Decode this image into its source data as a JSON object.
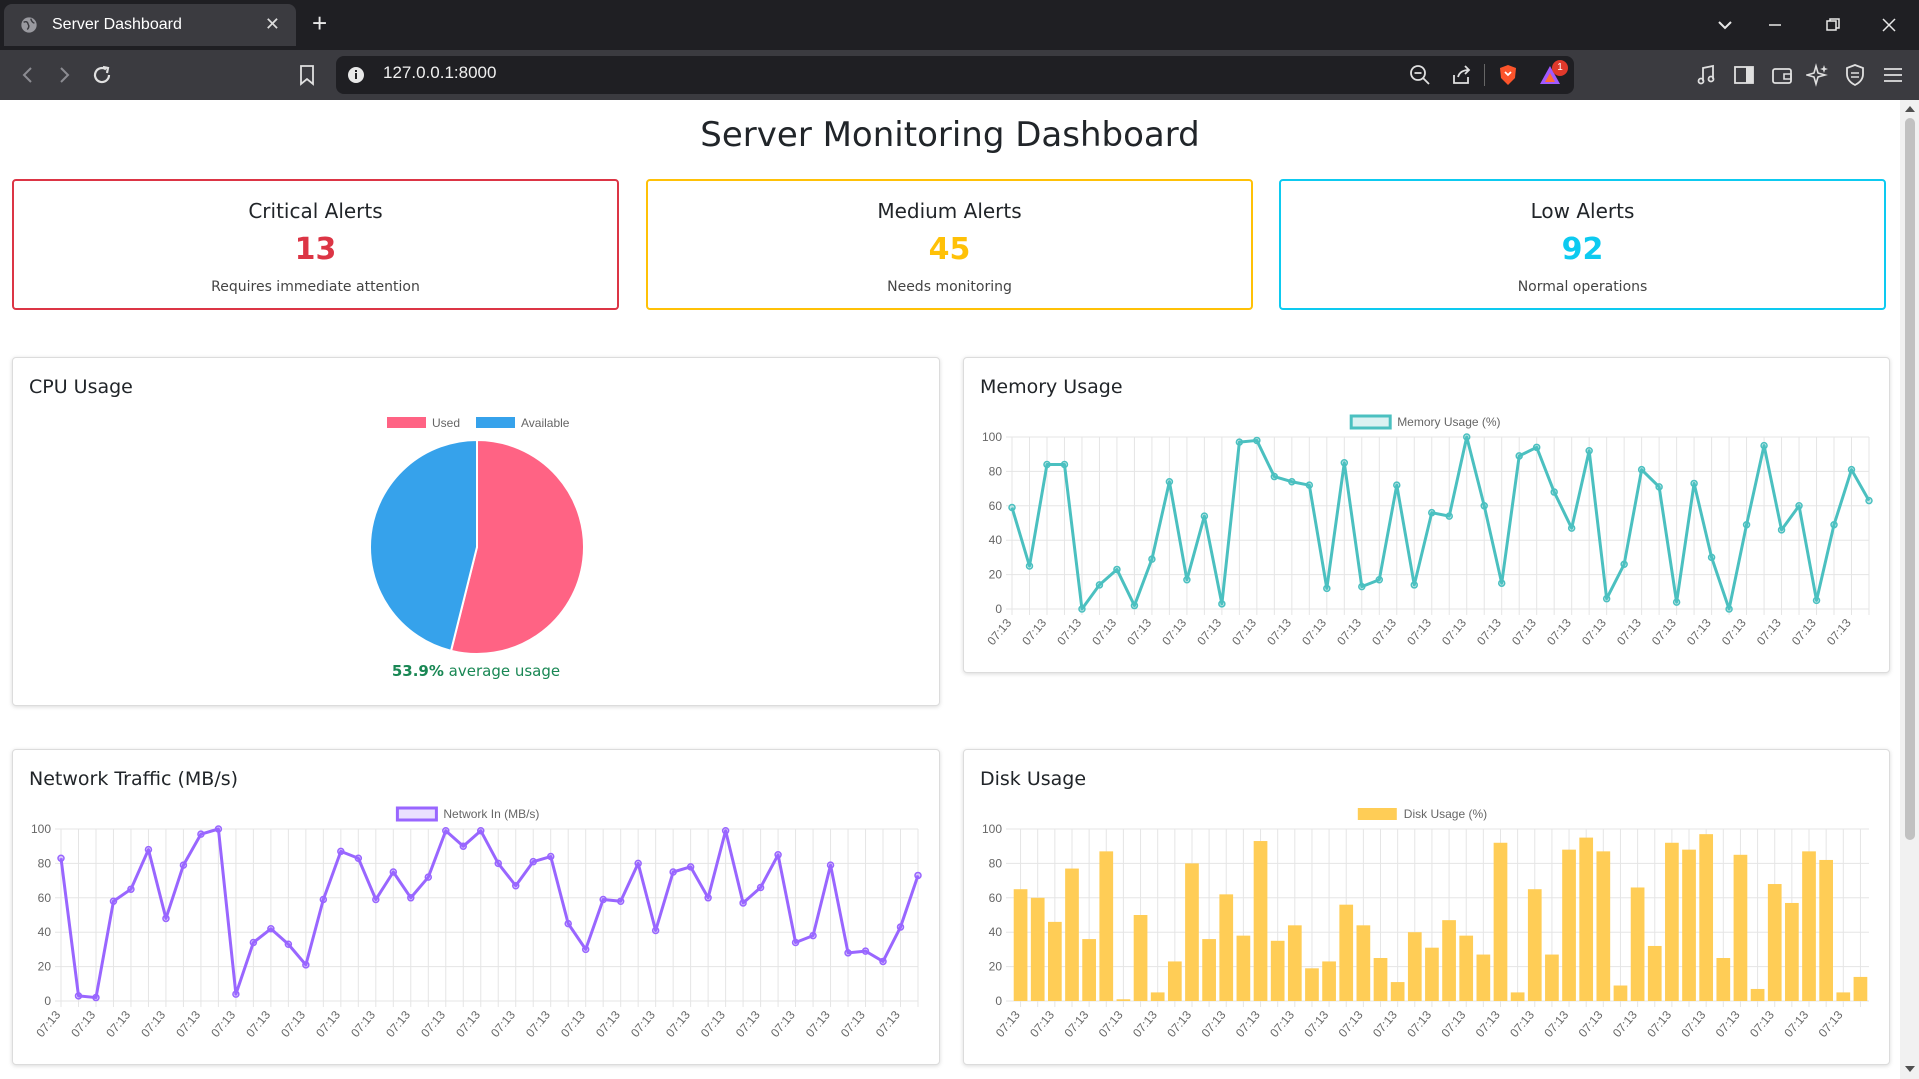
{
  "browser": {
    "tab_title": "Server Dashboard",
    "url": "127.0.0.1:8000",
    "shield_badge": "1"
  },
  "page": {
    "title": "Server Monitoring Dashboard"
  },
  "alerts": [
    {
      "title": "Critical Alerts",
      "count": "13",
      "subtitle": "Requires immediate attention",
      "color": "#dc3545"
    },
    {
      "title": "Medium Alerts",
      "count": "45",
      "subtitle": "Needs monitoring",
      "color": "#ffc107"
    },
    {
      "title": "Low Alerts",
      "count": "92",
      "subtitle": "Normal operations",
      "color": "#0dcaf0"
    }
  ],
  "panels": {
    "cpu": {
      "title": "CPU Usage",
      "avg_value": "53.9%",
      "avg_label": " average usage"
    },
    "memory": {
      "title": "Memory Usage"
    },
    "network": {
      "title": "Network Traffic (MB/s)"
    },
    "disk": {
      "title": "Disk Usage"
    }
  },
  "chart_data": [
    {
      "id": "cpu",
      "type": "pie",
      "title": "CPU Usage",
      "categories": [
        "Used",
        "Available"
      ],
      "values": [
        53.9,
        46.1
      ],
      "colors": [
        "#ff6384",
        "#36a2eb"
      ],
      "legend": "top"
    },
    {
      "id": "memory",
      "type": "line",
      "title": "Memory Usage",
      "series": [
        {
          "name": "Memory Usage (%)",
          "color": "#4bc0c0",
          "values": [
            59,
            25,
            84,
            84,
            0,
            14,
            23,
            2,
            29,
            74,
            17,
            54,
            3,
            97,
            98,
            77,
            74,
            72,
            12,
            85,
            13,
            17,
            72,
            14,
            56,
            54,
            100,
            60,
            15,
            89,
            94,
            68,
            47,
            92,
            6,
            26,
            81,
            71,
            4,
            73,
            30,
            0,
            49,
            95,
            46,
            60,
            5,
            49,
            81,
            63
          ]
        }
      ],
      "x_tick_label": "07:13",
      "x_tick_count": 25,
      "ylim": [
        0,
        100
      ],
      "y_ticks": [
        0,
        20,
        40,
        60,
        80,
        100
      ],
      "legend": "top",
      "grid": true
    },
    {
      "id": "network",
      "type": "line",
      "title": "Network Traffic (MB/s)",
      "series": [
        {
          "name": "Network In (MB/s)",
          "color": "#9966ff",
          "values": [
            83,
            3,
            2,
            58,
            65,
            88,
            48,
            79,
            97,
            100,
            4,
            34,
            42,
            33,
            21,
            59,
            87,
            83,
            59,
            75,
            60,
            72,
            99,
            90,
            99,
            80,
            67,
            81,
            84,
            45,
            30,
            59,
            58,
            80,
            41,
            75,
            78,
            60,
            99,
            57,
            66,
            85,
            34,
            38,
            79,
            28,
            29,
            23,
            43,
            73
          ]
        }
      ],
      "x_tick_label": "07:13",
      "x_tick_count": 25,
      "ylim": [
        0,
        100
      ],
      "y_ticks": [
        0,
        20,
        40,
        60,
        80,
        100
      ],
      "legend": "top",
      "grid": true
    },
    {
      "id": "disk",
      "type": "bar",
      "title": "Disk Usage",
      "series": [
        {
          "name": "Disk Usage (%)",
          "color": "#ffcd56",
          "values": [
            65,
            60,
            46,
            77,
            36,
            87,
            1,
            50,
            5,
            23,
            80,
            36,
            62,
            38,
            93,
            35,
            44,
            19,
            23,
            56,
            44,
            25,
            11,
            40,
            31,
            47,
            38,
            27,
            92,
            5,
            65,
            27,
            88,
            95,
            87,
            9,
            66,
            32,
            92,
            88,
            97,
            25,
            85,
            7,
            68,
            57,
            87,
            82,
            5,
            14
          ]
        }
      ],
      "x_tick_label": "07:13",
      "x_tick_count": 25,
      "ylim": [
        0,
        100
      ],
      "y_ticks": [
        0,
        20,
        40,
        60,
        80,
        100
      ],
      "legend": "top",
      "grid": true
    }
  ]
}
